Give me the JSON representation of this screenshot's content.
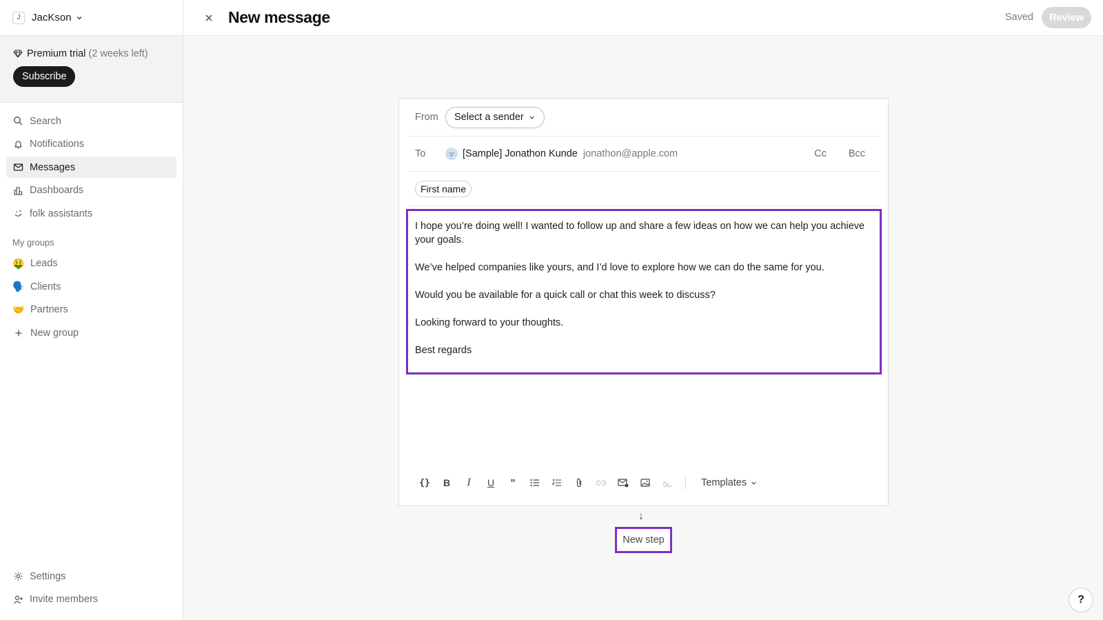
{
  "workspace": {
    "avatar_letter": "J",
    "name": "JacKson"
  },
  "trial": {
    "label": "Premium trial",
    "remaining": "(2 weeks left)",
    "subscribe_label": "Subscribe"
  },
  "nav": {
    "items": [
      {
        "label": "Search",
        "icon": "search-icon"
      },
      {
        "label": "Notifications",
        "icon": "bell-icon"
      },
      {
        "label": "Messages",
        "icon": "mail-icon",
        "active": true
      },
      {
        "label": "Dashboards",
        "icon": "bar-chart-icon"
      },
      {
        "label": "folk assistants",
        "icon": "assistant-icon"
      }
    ]
  },
  "groups": {
    "title": "My groups",
    "items": [
      {
        "label": "Leads",
        "emoji": "🤑"
      },
      {
        "label": "Clients",
        "emoji": "🗣️"
      },
      {
        "label": "Partners",
        "emoji": "🤝"
      }
    ],
    "new_label": "New group"
  },
  "bottom_nav": {
    "settings_label": "Settings",
    "invite_label": "Invite members"
  },
  "topbar": {
    "title": "New message",
    "saved_label": "Saved",
    "review_label": "Review"
  },
  "composer": {
    "from_label": "From",
    "sender_placeholder": "Select a sender",
    "to_label": "To",
    "recipient_name": "[Sample] Jonathon Kunde",
    "recipient_email": "jonathon@apple.com",
    "cc_label": "Cc",
    "bcc_label": "Bcc",
    "variable_chip": "First name",
    "body": [
      "I hope you’re doing well! I wanted to follow up and share a few ideas on how we can help you achieve your goals.",
      "We’ve helped companies like yours, and I’d love to explore how we can do the same for you.",
      "Would you be available for a quick call or chat this week to discuss?",
      "Looking forward to your thoughts.",
      "Best regards"
    ],
    "templates_label": "Templates",
    "accent_color": "#7b2fc9"
  },
  "step": {
    "arrow": "↓",
    "new_step_label": "New step"
  },
  "help_label": "?"
}
